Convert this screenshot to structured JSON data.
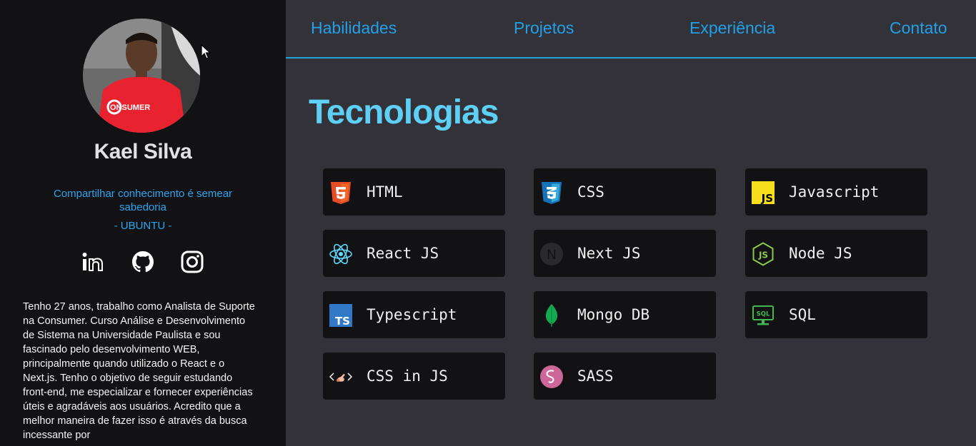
{
  "profile": {
    "name": "Kael Silva",
    "quote": "Compartilhar conhecimento é semear sabedoria",
    "motto": "- UBUNTU -",
    "shirt_text": "ONSUMER",
    "bio": "Tenho 27 anos, trabalho como Analista de Suporte na Consumer. Curso Análise e Desenvolvimento de Sistema na Universidade Paulista e sou fascinado pelo desenvolvimento WEB, principalmente quando utilizado o React e o Next.js. Tenho o objetivo de seguir estudando front-end, me especializar e fornecer experiências úteis e agradáveis aos usuários. Acredito que a melhor maneira de fazer isso é através da busca incessante por"
  },
  "socials": [
    {
      "icon": "linkedin-icon"
    },
    {
      "icon": "github-icon"
    },
    {
      "icon": "instagram-icon"
    }
  ],
  "nav": {
    "items": [
      "Habilidades",
      "Projetos",
      "Experiência",
      "Contato"
    ]
  },
  "section": {
    "title": "Tecnologias"
  },
  "technologies": [
    {
      "label": "HTML",
      "icon": "html5-icon"
    },
    {
      "label": "CSS",
      "icon": "css3-icon"
    },
    {
      "label": "Javascript",
      "icon": "javascript-icon",
      "icon_text": "JS"
    },
    {
      "label": "React JS",
      "icon": "react-icon"
    },
    {
      "label": "Next JS",
      "icon": "nextjs-icon",
      "icon_text": "N"
    },
    {
      "label": "Node JS",
      "icon": "nodejs-icon",
      "icon_text": "JS"
    },
    {
      "label": "Typescript",
      "icon": "typescript-icon",
      "icon_text": "TS"
    },
    {
      "label": "Mongo DB",
      "icon": "mongodb-icon"
    },
    {
      "label": "SQL",
      "icon": "sql-icon",
      "icon_text": "SQL"
    },
    {
      "label": "CSS in JS",
      "icon": "css-in-js-icon"
    },
    {
      "label": "SASS",
      "icon": "sass-icon"
    }
  ],
  "colors": {
    "accent": "#22a0e8",
    "title": "#5ed0f6",
    "sidebar_bg": "#121214",
    "main_bg": "#323238",
    "card_bg": "#121214"
  }
}
